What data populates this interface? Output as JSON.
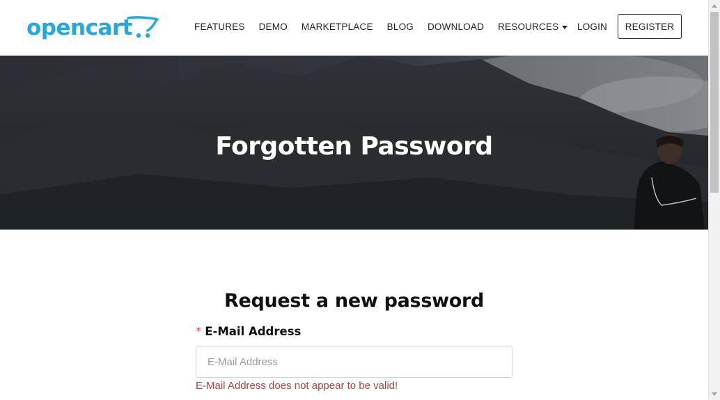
{
  "header": {
    "logo_text": "opencart",
    "nav": [
      {
        "label": "FEATURES"
      },
      {
        "label": "DEMO"
      },
      {
        "label": "MARKETPLACE"
      },
      {
        "label": "BLOG"
      },
      {
        "label": "DOWNLOAD"
      },
      {
        "label": "RESOURCES"
      }
    ],
    "login_label": "LOGIN",
    "register_label": "REGISTER"
  },
  "hero": {
    "title": "Forgotten Password"
  },
  "form": {
    "heading": "Request a new password",
    "required_marker": "*",
    "email_label": "E-Mail Address",
    "email_placeholder": "E-Mail Address",
    "email_value": "",
    "error_text": "E-Mail Address does not appear to be valid!"
  },
  "colors": {
    "brand": "#23a8e0",
    "error": "#a94442",
    "required": "#e0473a"
  },
  "icons": {
    "logo_cart": "shopping-cart-icon",
    "resources_caret": "caret-down-icon"
  }
}
